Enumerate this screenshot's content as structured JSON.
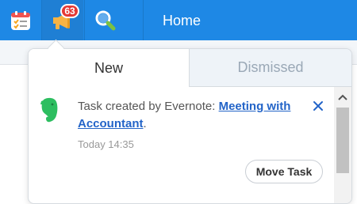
{
  "topbar": {
    "home_label": "Home",
    "notification_count": "63",
    "colors": {
      "bar": "#1e88e5",
      "badge": "#e53935"
    }
  },
  "icons": {
    "calendar": "calendar-checklist-icon",
    "notifications": "megaphone-icon",
    "search": "magnifier-icon",
    "evernote": "evernote-elephant-icon",
    "close": "close-x-icon",
    "scroll_up": "chevron-up-icon"
  },
  "popover": {
    "tabs": [
      {
        "label": "New",
        "active": true
      },
      {
        "label": "Dismissed",
        "active": false
      }
    ],
    "notification": {
      "prefix": "Task created by Evernote: ",
      "link": "Meeting with Accountant",
      "suffix": ".",
      "time": "Today 14:35",
      "action_label": "Move Task"
    }
  }
}
